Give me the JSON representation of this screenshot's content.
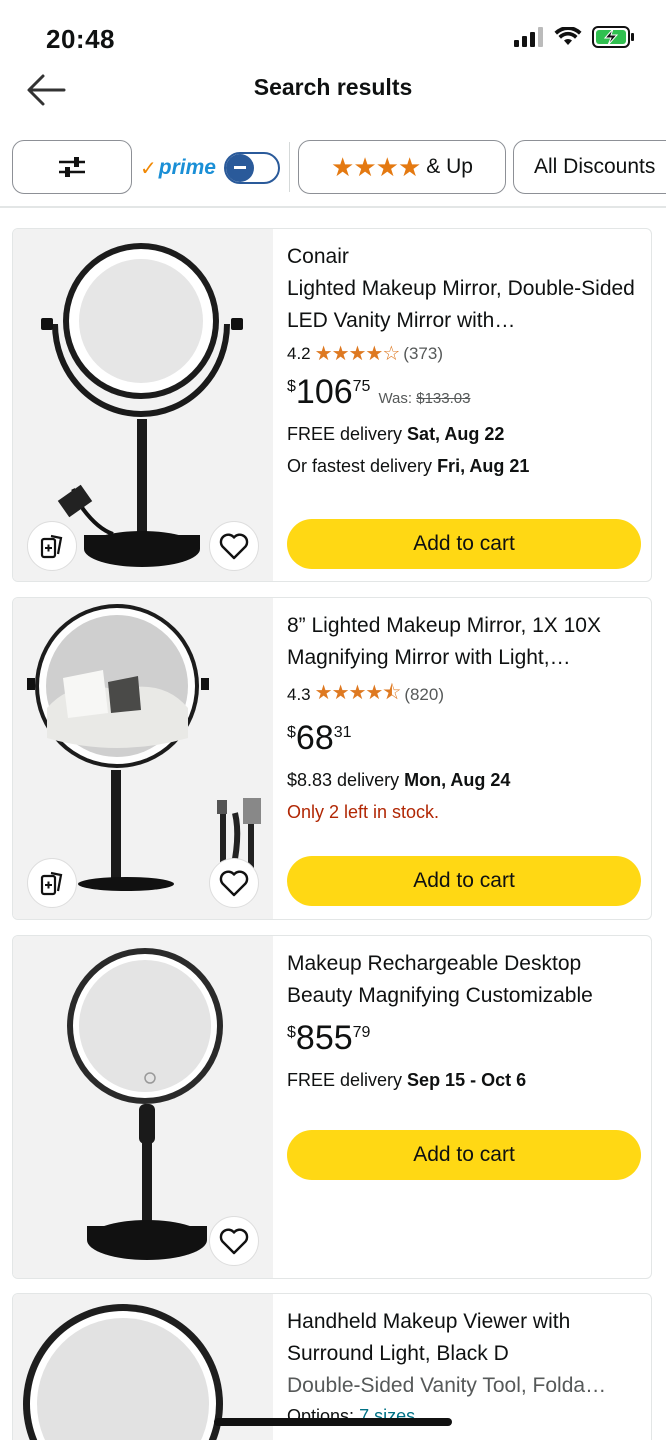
{
  "status": {
    "time": "20:48",
    "icons": [
      "signal-icon",
      "wifi-icon",
      "battery-charging-icon"
    ]
  },
  "header": {
    "title": "Search results",
    "back_icon": "arrow-left-icon"
  },
  "filters": {
    "settings_icon": "sliders-icon",
    "prime_check": "✓",
    "prime_label": "prime",
    "prime_toggle": "off",
    "stars_label": "★★★★",
    "stars_suffix": "& Up",
    "discounts_label": "All Discounts"
  },
  "products": [
    {
      "brand": "Conair",
      "title": "Lighted Makeup Mirror, Double-Sided LED Vanity Mirror with…",
      "rating": "4.2",
      "rating_stars": "★★★★☆",
      "rating_count": "(373)",
      "price_symbol": "$",
      "price_whole": "106",
      "price_fraction": "75",
      "was_label": "Was:",
      "was_price": "$133.03",
      "delivery_prefix": "FREE delivery",
      "delivery_date": "Sat, Aug 22",
      "fastest_prefix": "Or fastest delivery",
      "fastest_date": "Fri, Aug 21",
      "button": "Add to cart"
    },
    {
      "title": "8” Lighted Makeup Mirror, 1X 10X Magnifying Mirror with Light,…",
      "rating": "4.3",
      "rating_stars": "★★★★⯪",
      "rating_count": "(820)",
      "price_symbol": "$",
      "price_whole": "68",
      "price_fraction": "31",
      "delivery_prefix": "$8.83 delivery",
      "delivery_date": "Mon, Aug 24",
      "stock": "Only 2 left in stock.",
      "button": "Add to cart"
    },
    {
      "title": "Makeup Rechargeable Desktop Beauty Magnifying Customizable",
      "price_symbol": "$",
      "price_whole": "855",
      "price_fraction": "79",
      "delivery_prefix": "FREE delivery",
      "delivery_date": "Sep 15 - Oct 6",
      "button": "Add to cart"
    },
    {
      "title": "Handheld Makeup Viewer with Surround Light, Black D",
      "subtitle": "Double-Sided Vanity Tool, Folda…",
      "options_label": "Options:",
      "options_value": "7 sizes"
    }
  ],
  "colors": {
    "accent_button": "#ffd814",
    "star": "#de7921",
    "prime_blue": "#1a8fd6",
    "stock_red": "#b12704"
  }
}
